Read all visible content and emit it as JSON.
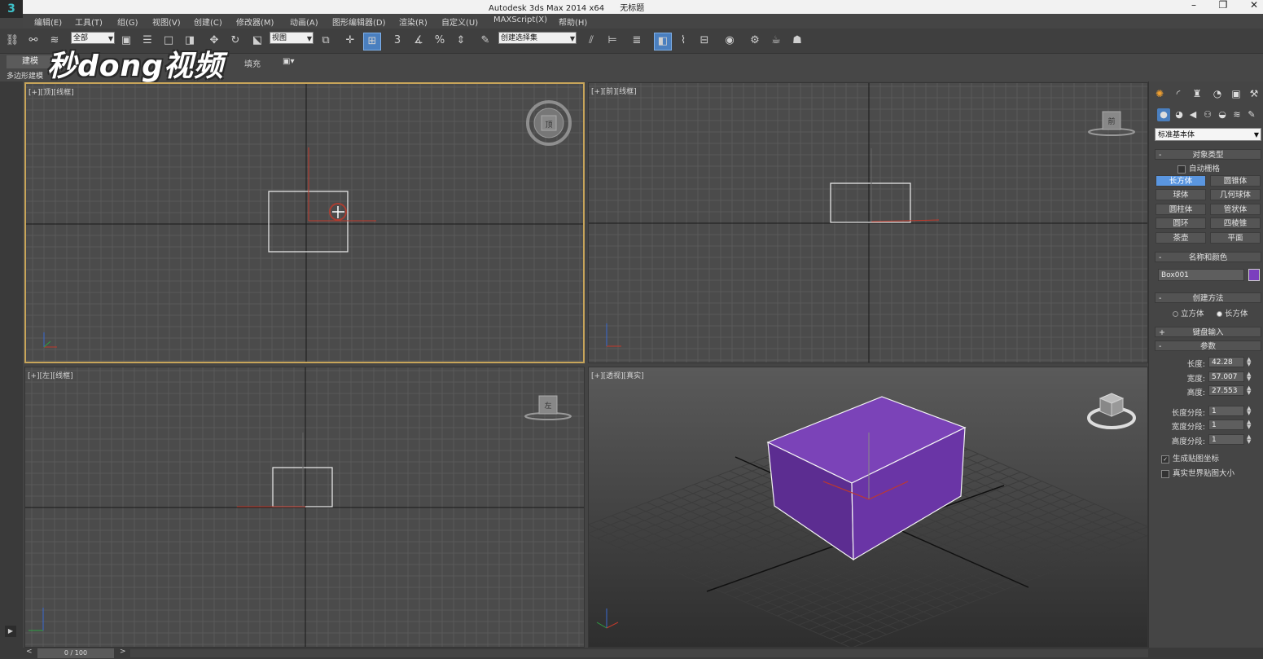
{
  "window": {
    "title": "Autodesk 3ds Max  2014 x64",
    "doc_title": "无标题",
    "minimize": "–",
    "maximize": "❐",
    "close": "✕"
  },
  "menu": [
    "编辑(E)",
    "工具(T)",
    "组(G)",
    "视图(V)",
    "创建(C)",
    "修改器(M)",
    "动画(A)",
    "图形编辑器(D)",
    "渲染(R)",
    "自定义(U)",
    "MAXScript(X)",
    "帮助(H)"
  ],
  "toolbar": {
    "selection_filter": "全部",
    "ref_coord": "视图",
    "named_selection": "创建选择集",
    "snap_3": "3",
    "percent_snap": "%",
    "active_icon": "select-and-manipulate-icon"
  },
  "ribbon": {
    "tab": "建模",
    "subtitle": "多边形建模",
    "fill_label": "填充"
  },
  "watermark": "秒dong视频",
  "viewports": {
    "top": "[+][顶][线框]",
    "front": "[+][前][线框]",
    "left": "[+][左][线框]",
    "perspective": "[+][透视][真实]",
    "front_cube_label": "前",
    "left_cube_label": "左",
    "top_cube_label": "顶"
  },
  "command_panel": {
    "primitive_type": "标准基本体",
    "object_type_title": "对象类型",
    "autogrid": "自动栅格",
    "objects": [
      "长方体",
      "圆锥体",
      "球体",
      "几何球体",
      "圆柱体",
      "管状体",
      "圆环",
      "四棱锥",
      "茶壶",
      "平面"
    ],
    "selected_object": "长方体",
    "name_color_title": "名称和颜色",
    "object_name": "Box001",
    "object_color": "#7b3fbe",
    "creation_method_title": "创建方法",
    "creation_cube": "立方体",
    "creation_box": "长方体",
    "keyboard_entry_title": "键盘输入",
    "parameters_title": "参数",
    "length_label": "长度:",
    "length_value": "42.28",
    "width_label": "宽度:",
    "width_value": "57.007",
    "height_label": "高度:",
    "height_value": "27.553",
    "length_segs_label": "长度分段:",
    "length_segs": "1",
    "width_segs_label": "宽度分段:",
    "width_segs": "1",
    "height_segs_label": "高度分段:",
    "height_segs": "1",
    "gen_mapping": "生成贴图坐标",
    "real_world": "真实世界贴图大小"
  },
  "timeline": {
    "frame": "0 / 100",
    "prev": "<",
    "next": ">"
  }
}
